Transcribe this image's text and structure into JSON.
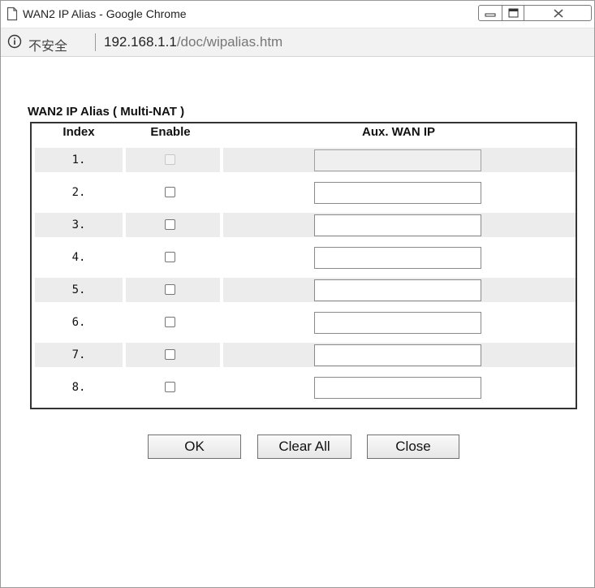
{
  "window": {
    "title": "WAN2 IP Alias - Google Chrome"
  },
  "addressbar": {
    "security_label": "不安全",
    "url_host": "192.168.1.1",
    "url_path": "/doc/wipalias.htm"
  },
  "section": {
    "title": "WAN2 IP Alias ( Multi-NAT )"
  },
  "table": {
    "headers": {
      "index": "Index",
      "enable": "Enable",
      "aux_wan_ip": "Aux. WAN IP"
    },
    "rows": [
      {
        "index": "1.",
        "enabled": false,
        "disabled": true,
        "ip": ""
      },
      {
        "index": "2.",
        "enabled": false,
        "disabled": false,
        "ip": ""
      },
      {
        "index": "3.",
        "enabled": false,
        "disabled": false,
        "ip": ""
      },
      {
        "index": "4.",
        "enabled": false,
        "disabled": false,
        "ip": ""
      },
      {
        "index": "5.",
        "enabled": false,
        "disabled": false,
        "ip": ""
      },
      {
        "index": "6.",
        "enabled": false,
        "disabled": false,
        "ip": ""
      },
      {
        "index": "7.",
        "enabled": false,
        "disabled": false,
        "ip": ""
      },
      {
        "index": "8.",
        "enabled": false,
        "disabled": false,
        "ip": ""
      }
    ]
  },
  "buttons": {
    "ok": "OK",
    "clear_all": "Clear All",
    "close": "Close"
  },
  "icons": {
    "page": "page-icon",
    "info": "info-icon",
    "minimize": "minimize-icon",
    "maximize": "maximize-icon",
    "close": "close-icon"
  }
}
